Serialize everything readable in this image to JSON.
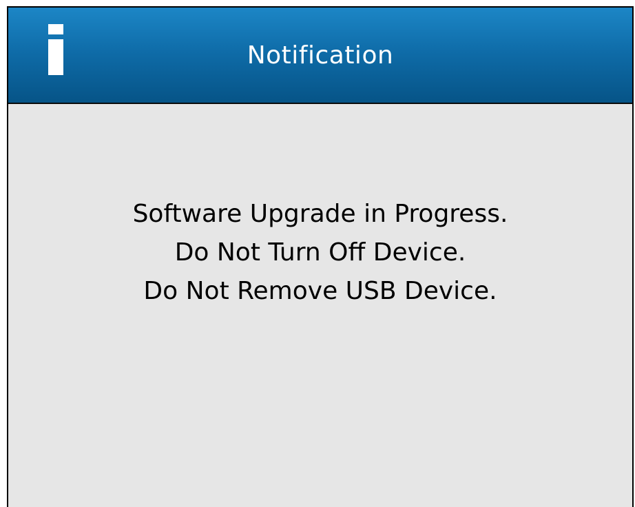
{
  "dialog": {
    "title": "Notification",
    "icon": "info-icon",
    "message_lines": [
      "Software Upgrade in Progress.",
      "Do Not Turn Off Device.",
      "Do Not Remove USB Device."
    ]
  },
  "colors": {
    "title_bar": "#0e6aa6",
    "title_text": "#ffffff",
    "body_background": "#e6e6e6",
    "message_text": "#000000"
  }
}
